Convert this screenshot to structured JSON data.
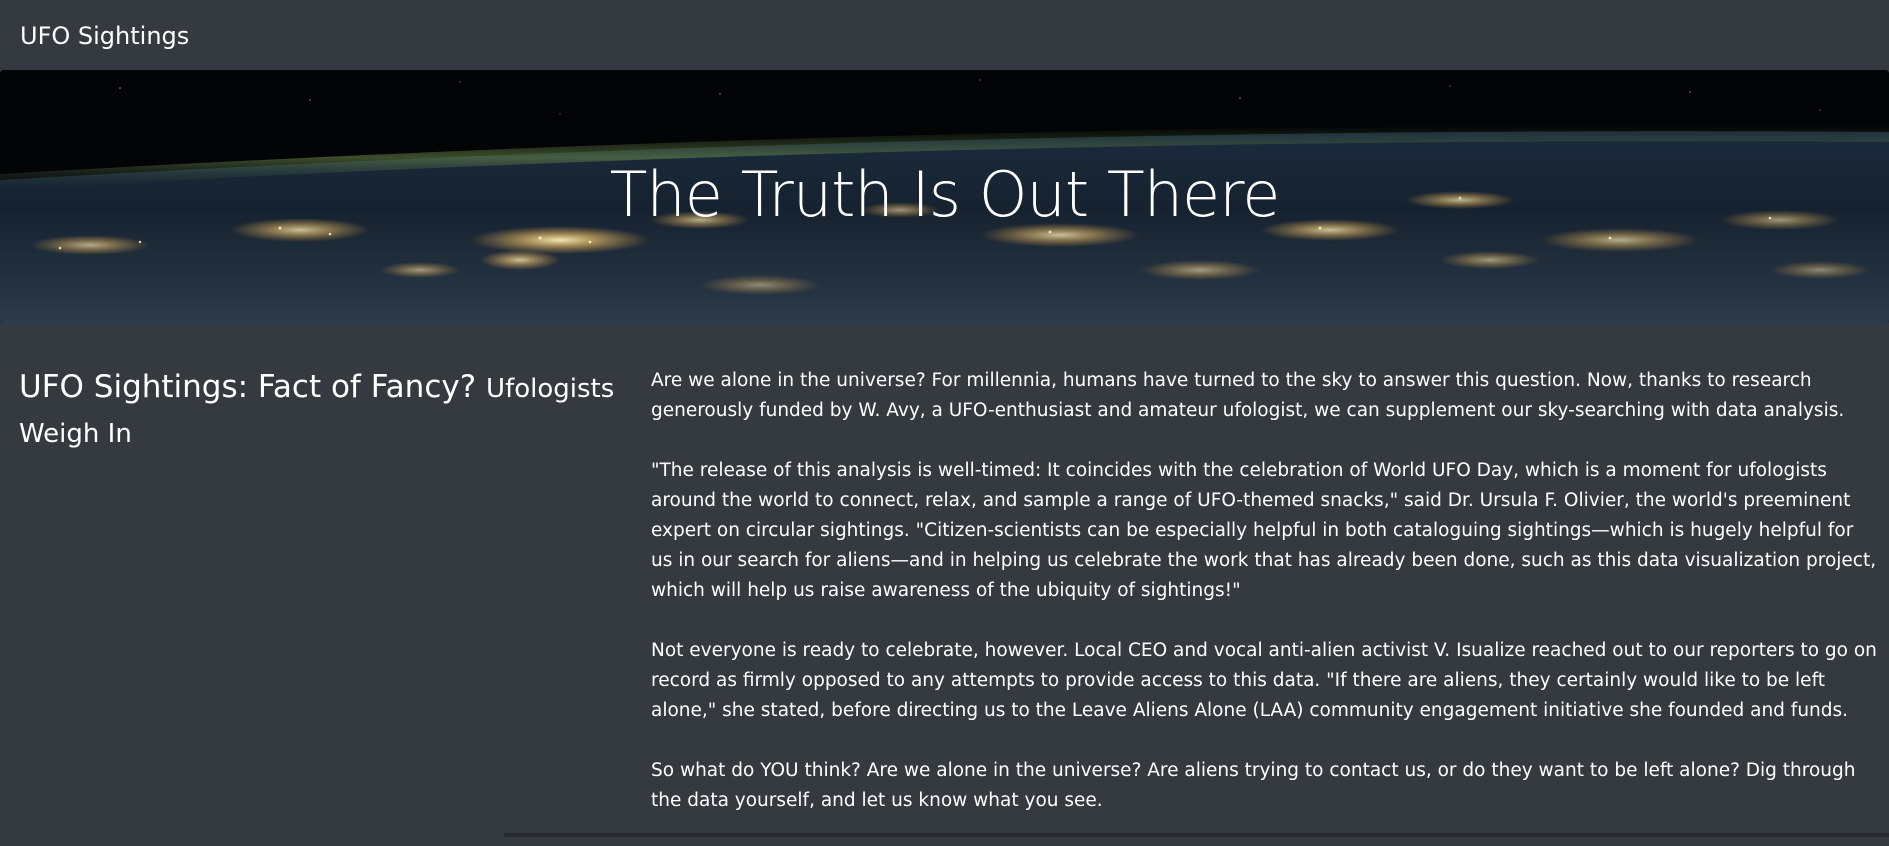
{
  "navbar": {
    "brand": "UFO Sightings"
  },
  "hero": {
    "title": "The Truth Is Out There"
  },
  "headline": {
    "main": "UFO Sightings: Fact of Fancy?",
    "sub": "Ufologists Weigh In"
  },
  "article": {
    "paragraphs": [
      "Are we alone in the universe? For millennia, humans have turned to the sky to answer this question. Now, thanks to research generously funded by W. Avy, a UFO-enthusiast and amateur ufologist, we can supplement our sky-searching with data analysis.",
      "\"The release of this analysis is well-timed: It coincides with the celebration of World UFO Day, which is a moment for ufologists around the world to connect, relax, and sample a range of UFO-themed snacks,\" said Dr. Ursula F. Olivier, the world's preeminent expert on circular sightings. \"Citizen-scientists can be especially helpful in both cataloguing sightings—which is hugely helpful for us in our search for aliens—and in helping us celebrate the work that has already been done, such as this data visualization project, which will help us raise awareness of the ubiquity of sightings!\"",
      "Not everyone is ready to celebrate, however. Local CEO and vocal anti-alien activist V. Isualize reached out to our reporters to go on record as firmly opposed to any attempts to provide access to this data. \"If there are aliens, they certainly would like to be left alone,\" she stated, before directing us to the Leave Aliens Alone (LAA) community engagement initiative she founded and funds.",
      "So what do YOU think? Are we alone in the universe? Are aliens trying to contact us, or do they want to be left alone? Dig through the data yourself, and let us know what you see."
    ]
  },
  "colors": {
    "background": "#343a40",
    "text": "#ffffff",
    "city_lights": "#ffd98a"
  }
}
